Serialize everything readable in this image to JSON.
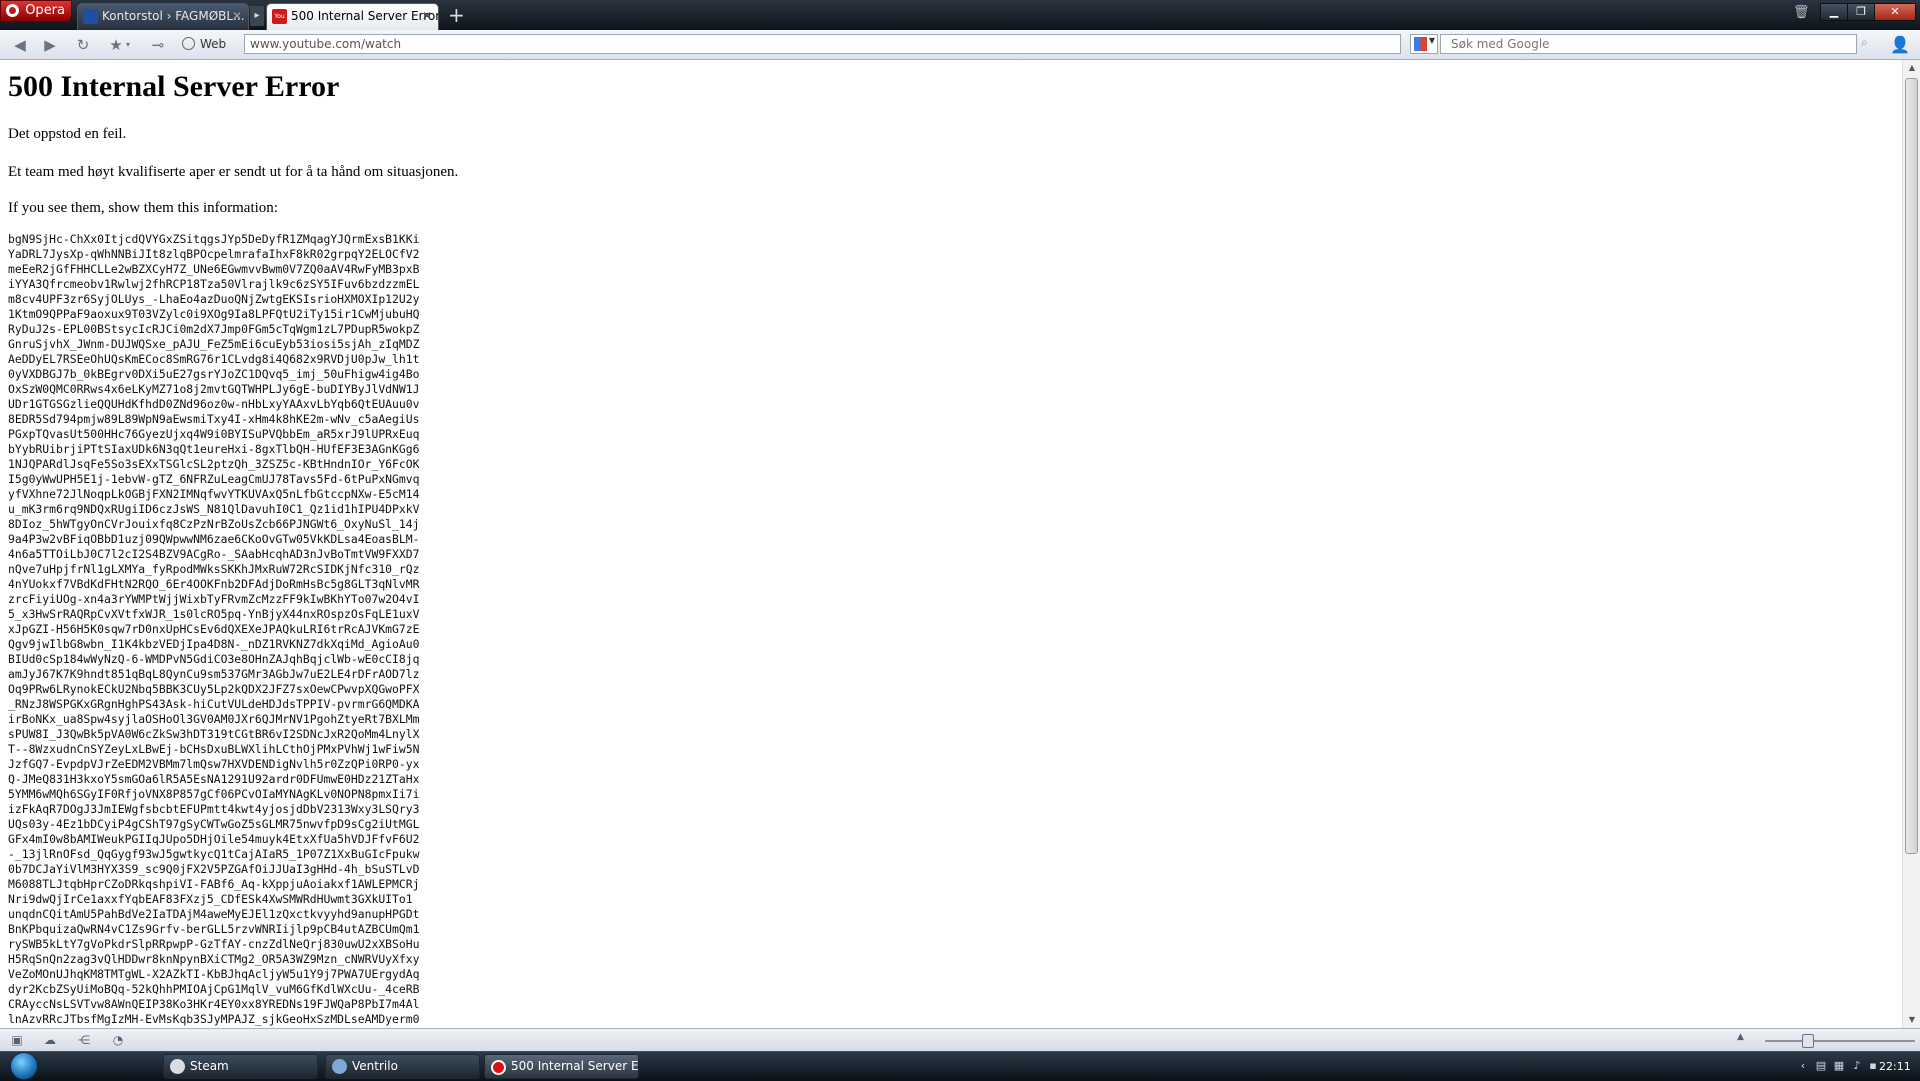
{
  "browser": {
    "menu_label": "Opera",
    "tabs": [
      {
        "label": "Kontorstol › FAGMØBL...",
        "active": false
      },
      {
        "label": "500 Internal Server Error",
        "active": true
      }
    ],
    "new_tab_symbol": "+",
    "web_label": "Web",
    "url": "www.youtube.com/watch",
    "search_placeholder": "Søk med Google"
  },
  "page": {
    "heading": "500 Internal Server Error",
    "line1": "Det oppstod en feil.",
    "line2": "Et team med høyt kvalifiserte aper er sendt ut for å ta hånd om situasjonen.",
    "line3": "If you see them, show them this information:",
    "debug_info": "bgN9SjHc-ChXx0ItjcdQVYGxZSitqgsJYp5DeDyfR1ZMqagYJQrmExsB1KKi\nYaDRL7JysXp-qWhNNBiJIt8zlqBPOcpelmrafaIhxF8kR02grpqY2ELOCfV2\nmeEeR2jGfFHHCLLe2wBZXCyH7Z_UNe6EGwmvvBwm0V7ZQ0aAV4RwFyMB3pxB\niYYA3Qfrcmeobv1Rwlwj2fhRCP18Tza50Vlrajlk9c6zSY5IFuv6bzdzzmEL\nm8cv4UPF3zr6SyjOLUys_-LhaEo4azDuoQNjZwtgEKSIsrioHXMOXIp12U2y\n1KtmO9QPPaF9aoxux9T03VZylc0i9XOg9Ia8LPFQtU2iTy15ir1CwMjubuHQ\nRyDuJ2s-EPL00BStsycIcRJCi0m2dX7Jmp0FGm5cTqWgm1zL7PDupR5wokpZ\nGnruSjvhX_JWnm-DUJWQSxe_pAJU_FeZ5mEi6cuEyb53iosi5sjAh_zIqMDZ\nAeDDyEL7RSEeOhUQsKmECoc8SmRG76r1CLvdg8i4Q682x9RVDjU0pJw_lh1t\n0yVXDBGJ7b_0kBEgrv0DXi5uE27gsrYJoZC1DQvq5_imj_50uFhigw4ig4Bo\nOxSzW0QMC0RRws4x6eLKyMZ71o8j2mvtGQTWHPLJy6gE-buDIYByJlVdNW1J\nUDr1GTGSGzlieQQUHdKfhdD0ZNd96oz0w-nHbLxyYAAxvLbYqb6QtEUAuu0v\n8EDR5Sd794pmjw89L89WpN9aEwsmiTxy4I-xHm4k8hKE2m-wNv_c5aAegiUs\nPGxpTQvasUt500HHc76GyezUjxq4W9i0BYISuPVQbbEm_aR5xrJ9lUPRxEuq\nbYybRUibrjiPTtSIaxUDk6N3qQt1eureHxi-8gxTlbQH-HUfEF3E3AGnKGg6\n1NJQPARdlJsqFe5So3sEXxTSGlcSL2ptzQh_3ZSZ5c-KBtHndnIOr_Y6FcOK\nI5g0yWwUPH5E1j-1ebvW-gTZ_6NFRZuLeagCmUJ78Tavs5Fd-6tPuPxNGmvq\nyfVXhne72JlNoqpLkOGBjFXN2IMNqfwvYTKUVAxQ5nLfbGtccpNXw-E5cM14\nu_mK3rm6rq9NDQxRUgiID6czJsWS_N81QlDavuhI0C1_Qz1id1hIPU4DPxkV\n8DIoz_5hWTgyOnCVrJouixfq8CzPzNrBZoUsZcb66PJNGWt6_OxyNuSl_14j\n9a4P3w2vBFiqOBbD1uzj09QWpwwNM6zae6CKoOvGTw05VkKDLsa4EoasBLM-\n4n6a5TTOiLbJ0C7l2cI2S4BZV9ACgRo-_SAabHcqhAD3nJvBoTmtVW9FXXD7\nnQve7uHpjfrNl1gLXMYa_fyRpodMWksSKKhJMxRuW72RcSIDKjNfc310_rQz\n4nYUokxf7VBdKdFHtN2RQO_6Er4OOKFnb2DFAdjDoRmHsBc5g8GLT3qNlvMR\nzrcFiyiUOg-xn4a3rYWMPtWjjWixbTyFRvmZcMzzFF9kIwBKhYTo07w2O4vI\n5_x3HwSrRAQRpCvXVtfxWJR_1s0lcRO5pq-YnBjyX44nxROspzOsFqLE1uxV\nxJpGZI-H56H5K0sqw7rD0nxUpHCsEv6dQXEXeJPAQkuLRI6trRcAJVKmG7zE\nQgv9jwIlbG8wbn_I1K4kbzVEDjIpa4D8N-_nDZ1RVKNZ7dkXqiMd_AgioAu0\nBIUd0cSp184wWyNzQ-6-WMDPvN5GdiCO3e8OHnZAJqhBqjclWb-wE0cCI8jq\namJyJ67K7K9hndt851qBqL8QynCu9sm537GMr3AGbJw7uE2LE4rDFrAOD7lz\nOq9PRw6LRynokECkU2Nbq5BBK3CUy5Lp2kQDX2JFZ7sxOewCPwvpXQGwoPFX\n_RNzJ8WSPGKxGRgnHghPS43Ask-hiCutVULdeHDJdsTPPIV-pvrmrG6QMDKA\nirBoNKx_ua8Spw4syjlaOSHoOl3GV0AM0JXr6QJMrNV1PgohZtyeRt7BXLMm\nsPUW8I_J3QwBk5pVA0W6cZkSw3hDT319tCGtBR6vI2SDNcJxR2QoMm4LnylX\nT--8WzxudnCnSYZeyLxLBwEj-bCHsDxuBLWXlihLCthOjPMxPVhWj1wFiw5N\nJzfGQ7-EvpdpVJrZeEDM2VBMm7lmQsw7HXVDENDigNvlh5r0ZzQPi0RP0-yx\nQ-JMeQ831H3kxoY5smGOa6lR5A5EsNA1291U92ardr0DFUmwE0HDz21ZTaHx\n5YMM6wMQh6SGyIF0RfjoVNX8P857gCf06PCvOIaMYNAgKLv0NOPN8pmxIi7i\nizFkAqR7DOgJ3JmIEWgfsbcbtEFUPmtt4kwt4yjosjdDbV2313Wxy3LSQry3\nUQs03y-4Ez1bDCyiP4gCShT97gSyCWTwGoZ5sGLMR75nwvfpD9sCg2iUtMGL\nGFx4mI0w8bAMIWeukPGIIqJUpo5DHjOile54muyk4EtxXfUa5hVDJFfvF6U2\n-_13jlRnOFsd_QqGygf93wJ5gwtkycQ1tCajAIaR5_1P07Z1XxBuGIcFpukw\n0b7DCJaYiVlM3HYX3S9_sc9Q0jFX2V5PZGAfOiJJUaI3gHHd-4h_bSuSTLvD\nM6088TLJtqbHprCZoDRkqshpiVI-FABf6_Aq-kXppjuAoiakxf1AWLEPMCRj\nNri9dwQjIrCe1axxfYqbEAF83FXzj5_CDfESk4XwSMWRdHUwmt3GXkUITo1\nunqdnCQitAmU5PahBdVe2IaTDAjM4aweMyEJEl1zQxctkvyyhd9anupHPGDt\nBnKPbquizaQwRN4vC1Zs9Grfv-berGLL5rzvWNRIijlp9pCB4utAZBCUmQm1\nrySWB5kLtY7gVoPkdrSlpRRpwpP-GzTfAY-cnzZdlNeQrj830uwU2xXBSoHu\nH5RqSnQn2zag3vQlHDDwr8knNpynBXiCTMg2_OR5A3WZ9Mzn_cNWRVUyXfxy\nVeZoMOnUJhqKM8TMTgWL-X2AZkTI-KbBJhqAcljyW5u1Y9j7PWA7UErgydAq\ndyr2KcbZSyUiMoBQq-52kQhhPMIOAjCpG1MqlV_vuM6GfKdlWXcUu-_4ceRB\nCRAyccNsLSVTvw8AWnQEIP38Ko3HKr4EY0xx8YREDNs19FJWQaP8PbI7m4Al\nlnAzvRRcJTbsfMgIzMH-EvMsKqb3SJyMPAJZ_sjkGeoHxSzMDLseAMDyerm0"
  },
  "statusbar": {
    "icons": [
      "panel-icon",
      "cloud-icon",
      "share-icon",
      "speed-dial-icon"
    ]
  },
  "taskbar": {
    "items": [
      {
        "label": "Steam"
      },
      {
        "label": "Ventrilo"
      },
      {
        "label": "500 Internal Server E..."
      }
    ],
    "clock": "22:11"
  }
}
